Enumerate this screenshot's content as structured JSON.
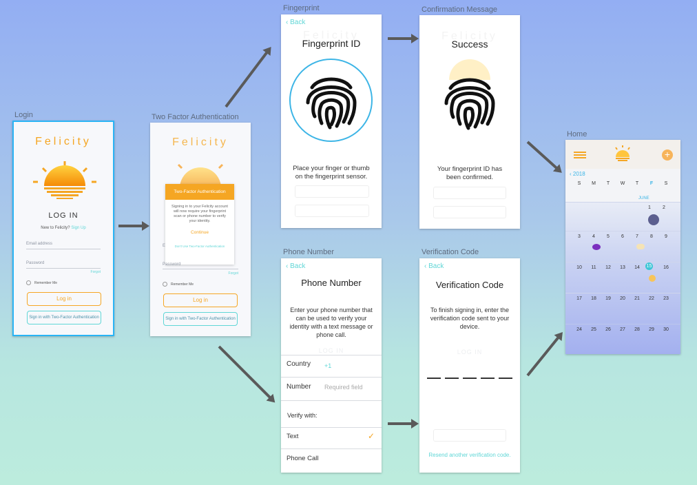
{
  "labels": {
    "login": "Login",
    "two_factor": "Two Factor Authentication",
    "fingerprint": "Fingerprint",
    "confirmation": "Confirmation Message",
    "phone": "Phone Number",
    "verification": "Verification Code",
    "home": "Home"
  },
  "login": {
    "brand": "Felicity",
    "heading": "LOG IN",
    "new_text": "New to Felicity?",
    "signup": "Sign Up",
    "email_placeholder": "Email address",
    "password_placeholder": "Password",
    "forgot": "Forgot",
    "remember": "Remember Me",
    "login_button": "Log in",
    "two_factor_button": "Sign in with Two-Factor Authentication"
  },
  "two_factor": {
    "brand": "Felicity",
    "modal_title": "Two-Factor Authentication",
    "modal_body": "Signing in to your Felicity account will now require your fingerprint scan or phone number to verify your identity.",
    "continue": "Continue",
    "dont_use": "Don't Use Two-Factor Authentication",
    "password_placeholder": "Password",
    "forgot": "Forgot",
    "remember": "Remember Me",
    "login_button": "Log in",
    "two_factor_button": "Sign in with Two-Factor Authentication",
    "email_partial": "E"
  },
  "fingerprint": {
    "back": "Back",
    "title": "Fingerprint ID",
    "instruction": "Place your finger or thumb on the fingerprint sensor.",
    "ghost_brand": "Felicity"
  },
  "confirmation": {
    "title": "Success",
    "message": "Your fingerprint ID has been confirmed.",
    "ghost_brand": "Felicity"
  },
  "phone": {
    "back": "Back",
    "title": "Phone Number",
    "instruction": "Enter your phone number that can be used to verify your identity with a text message or phone call.",
    "country_label": "Country",
    "country_value": "+1",
    "number_label": "Number",
    "number_placeholder": "Required field",
    "verify_with": "Verify with:",
    "option_text": "Text",
    "option_call": "Phone Call",
    "ghost_login": "LOG IN"
  },
  "verification": {
    "back": "Back",
    "title": "Verification Code",
    "instruction": "To finish signing in, enter the verification code sent to your device.",
    "resend": "Resend another verification code.",
    "ghost_login": "LOG IN"
  },
  "home": {
    "year": "2018",
    "weekdays": [
      "S",
      "M",
      "T",
      "W",
      "T",
      "F",
      "S"
    ],
    "month": "JUNE",
    "weeks": [
      [
        "",
        "",
        "",
        "",
        "",
        "1",
        "2"
      ],
      [
        "3",
        "4",
        "5",
        "6",
        "7",
        "8",
        "9"
      ],
      [
        "10",
        "11",
        "12",
        "13",
        "14",
        "15",
        "16"
      ],
      [
        "17",
        "18",
        "19",
        "20",
        "21",
        "22",
        "23"
      ],
      [
        "24",
        "25",
        "26",
        "27",
        "28",
        "29",
        "30"
      ]
    ],
    "today": "15"
  },
  "colors": {
    "accent": "#f5a623",
    "teal": "#5fd6d6",
    "frame_selected": "#2ab4f5",
    "arrow": "#5a5a5a"
  }
}
